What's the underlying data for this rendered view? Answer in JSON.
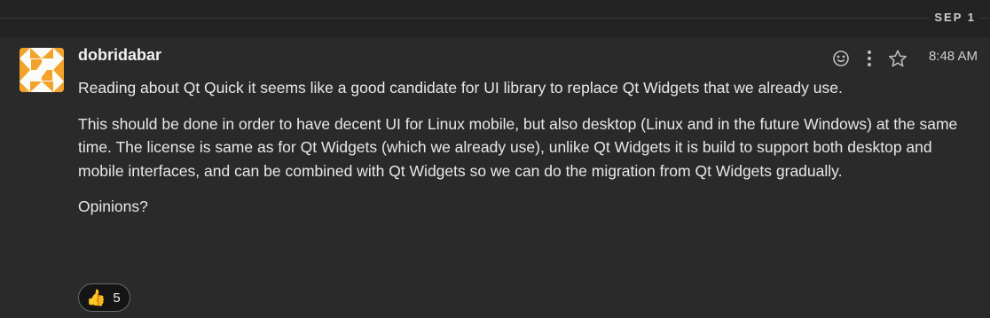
{
  "divider": {
    "date": "SEP 1"
  },
  "message": {
    "sender": "dobridabar",
    "time": "8:48 AM",
    "paragraphs": [
      "Reading about Qt Quick it seems like a good candidate for UI library to replace Qt Widgets that we already use.",
      "This should be done in order to have decent UI for Linux mobile, but also desktop (Linux and in the future Windows) at the same time. The license is same as for Qt Widgets (which we already use), unlike Qt Widgets it is build to support both desktop and mobile interfaces, and can be combined with Qt Widgets so we can do the migration from Qt Widgets gradually.",
      "Opinions?"
    ],
    "reaction": {
      "emoji": "👍",
      "count": "5"
    },
    "actions": {
      "react_icon": "smiley-icon",
      "more_icon": "kebab-menu-icon",
      "star_icon": "star-icon"
    }
  },
  "colors": {
    "background": "#232323",
    "message_bg": "#2a2a2a",
    "avatar_orange": "#f3a22a"
  }
}
